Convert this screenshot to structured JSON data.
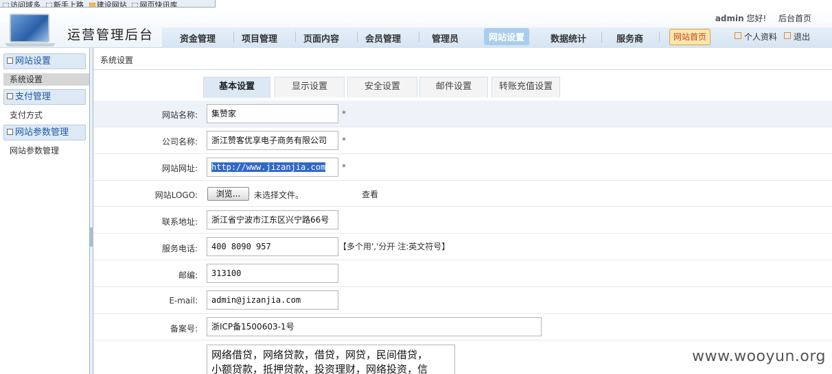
{
  "favorites": [
    "访问域多",
    "新手上路",
    "建设网站",
    "网页快讯库"
  ],
  "header": {
    "app_title": "运营管理后台",
    "user_name": "admin",
    "greeting": "您好!",
    "admin_home": "后台首页",
    "profile": "个人资料",
    "logout": "退出"
  },
  "nav": {
    "items": [
      "资金管理",
      "项目管理",
      "页面内容",
      "会员管理",
      "管理员",
      "网站设置",
      "数据统计",
      "服务商"
    ],
    "active_index": 5,
    "site_home": "网站首页"
  },
  "sidebar": {
    "groups": [
      {
        "title": "网站设置",
        "items": [
          "系统设置"
        ]
      },
      {
        "title": "支付管理",
        "items": [
          "支付方式"
        ]
      },
      {
        "title": "网站参数管理",
        "items": [
          "网站参数管理"
        ]
      }
    ]
  },
  "breadcrumb": "系统设置",
  "tabs": [
    "基本设置",
    "显示设置",
    "安全设置",
    "邮件设置",
    "转账充值设置"
  ],
  "form": {
    "site_name": {
      "label": "网站名称:",
      "value": "集赞家",
      "required": "*"
    },
    "company_name": {
      "label": "公司名称:",
      "value": "浙江赞客优享电子商务有限公司",
      "required": "*"
    },
    "site_url": {
      "label": "网站网址:",
      "value": "http://www.jizanjia.com",
      "required": "*"
    },
    "site_logo": {
      "label": "网站LOGO:",
      "browse": "浏览...",
      "no_file": "未选择文件。",
      "view": "查看"
    },
    "address": {
      "label": "联系地址:",
      "value": "浙江省宁波市江东区兴宁路66号"
    },
    "phone": {
      "label": "服务电话:",
      "value": "400 8090 957",
      "hint": "【多个用','分开 注:英文符号】"
    },
    "zipcode": {
      "label": "邮编:",
      "value": "313100"
    },
    "email": {
      "label": "E-mail:",
      "value": "admin@jizanjia.com"
    },
    "icp": {
      "label": "备案号:",
      "value": "浙ICP备1500603-1号"
    },
    "keywords": {
      "line1": "网络借贷，网络贷款，借贷，网贷，民间借贷，",
      "line2": "小额贷款，抵押贷款，投资理财，网络投资，信"
    }
  },
  "watermark": "www.wooyun.org",
  "colors": {
    "nav_active": "#a8cdee",
    "site_home_bg": "#fde6ad",
    "selection": "#3169c6"
  }
}
